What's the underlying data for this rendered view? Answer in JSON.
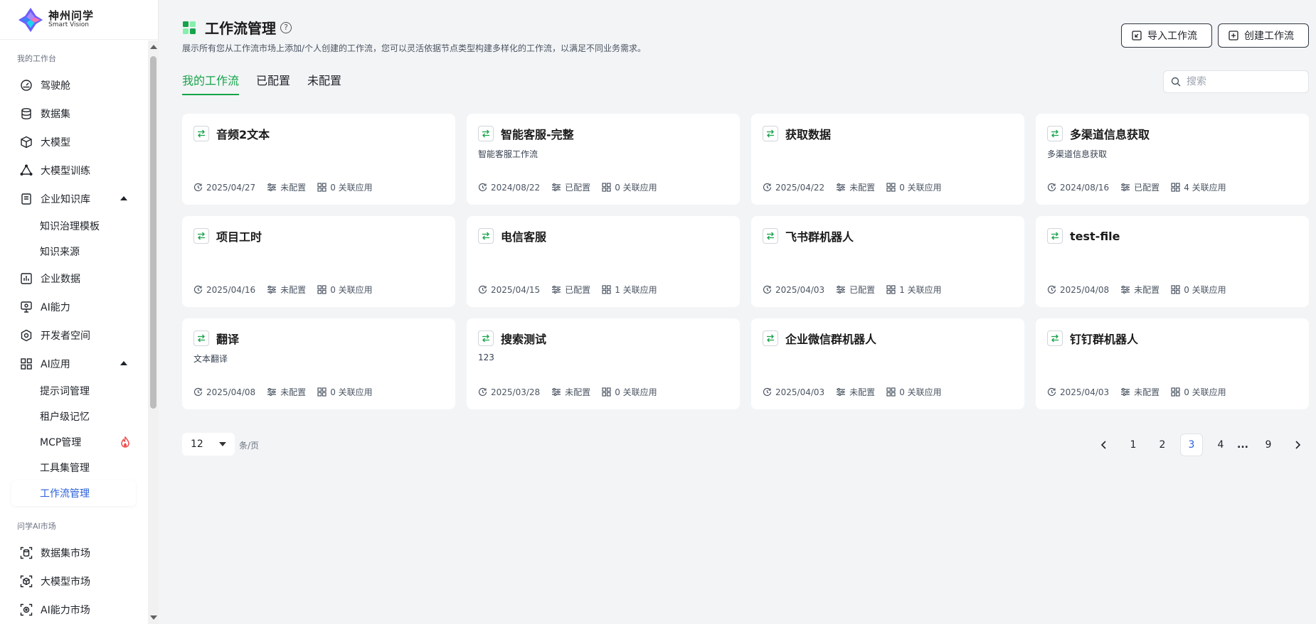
{
  "brand": {
    "name_cn": "神州问学",
    "name_en": "Smart Vision"
  },
  "sidebar": {
    "section1_title": "我的工作台",
    "items": [
      {
        "label": "驾驶舱",
        "icon": "dashboard-icon"
      },
      {
        "label": "数据集",
        "icon": "database-icon"
      },
      {
        "label": "大模型",
        "icon": "cube-icon"
      },
      {
        "label": "大模型训练",
        "icon": "training-icon"
      },
      {
        "label": "企业知识库",
        "icon": "knowledge-icon",
        "expanded": true
      },
      {
        "label": "知识治理模板",
        "sub": true
      },
      {
        "label": "知识来源",
        "sub": true
      },
      {
        "label": "企业数据",
        "icon": "chart-icon"
      },
      {
        "label": "AI能力",
        "icon": "monitor-icon"
      },
      {
        "label": "开发者空间",
        "icon": "developer-icon"
      },
      {
        "label": "AI应用",
        "icon": "apps-icon",
        "expanded": true
      },
      {
        "label": "提示词管理",
        "sub": true
      },
      {
        "label": "租户级记忆",
        "sub": true
      },
      {
        "label": "MCP管理",
        "sub": true,
        "hot": true
      },
      {
        "label": "工具集管理",
        "sub": true
      },
      {
        "label": "工作流管理",
        "sub": true,
        "active": true
      }
    ],
    "section2_title": "问学AI市场",
    "market_items": [
      {
        "label": "数据集市场",
        "icon": "dataset-market-icon"
      },
      {
        "label": "大模型市场",
        "icon": "model-market-icon"
      },
      {
        "label": "AI能力市场",
        "icon": "ai-market-icon"
      }
    ]
  },
  "header": {
    "title": "工作流管理",
    "help": "?",
    "description": "展示所有您从工作流市场上添加/个人创建的工作流，您可以灵活依据节点类型构建多样化的工作流，以满足不同业务需求。",
    "import_label": "导入工作流",
    "create_label": "创建工作流"
  },
  "tabs": [
    {
      "label": "我的工作流",
      "active": true
    },
    {
      "label": "已配置",
      "active": false
    },
    {
      "label": "未配置",
      "active": false
    }
  ],
  "search": {
    "placeholder": "搜索",
    "value": ""
  },
  "cards": [
    {
      "title": "音频2文本",
      "desc": "",
      "date": "2025/04/27",
      "status": "未配置",
      "apps": "0 关联应用"
    },
    {
      "title": "智能客服-完整",
      "desc": "智能客服工作流",
      "date": "2024/08/22",
      "status": "已配置",
      "apps": "0 关联应用"
    },
    {
      "title": "获取数据",
      "desc": "",
      "date": "2025/04/22",
      "status": "未配置",
      "apps": "0 关联应用"
    },
    {
      "title": "多渠道信息获取",
      "desc": "多渠道信息获取",
      "date": "2024/08/16",
      "status": "已配置",
      "apps": "4 关联应用"
    },
    {
      "title": "项目工时",
      "desc": "",
      "date": "2025/04/16",
      "status": "未配置",
      "apps": "0 关联应用"
    },
    {
      "title": "电信客服",
      "desc": "",
      "date": "2025/04/15",
      "status": "已配置",
      "apps": "1 关联应用"
    },
    {
      "title": "飞书群机器人",
      "desc": "",
      "date": "2025/04/03",
      "status": "已配置",
      "apps": "1 关联应用"
    },
    {
      "title": "test-file",
      "desc": "",
      "date": "2025/04/08",
      "status": "未配置",
      "apps": "0 关联应用"
    },
    {
      "title": "翻译",
      "desc": "文本翻译",
      "date": "2025/04/08",
      "status": "未配置",
      "apps": "0 关联应用"
    },
    {
      "title": "搜索测试",
      "desc": "123",
      "date": "2025/03/28",
      "status": "未配置",
      "apps": "0 关联应用"
    },
    {
      "title": "企业微信群机器人",
      "desc": "",
      "date": "2025/04/03",
      "status": "未配置",
      "apps": "0 关联应用"
    },
    {
      "title": "钉钉群机器人",
      "desc": "",
      "date": "2025/04/03",
      "status": "未配置",
      "apps": "0 关联应用"
    }
  ],
  "pagination": {
    "page_size": "12",
    "unit": "条/页",
    "pages": [
      "1",
      "2",
      "3",
      "4",
      "...",
      "9"
    ],
    "current": "3"
  },
  "colors": {
    "accent_green": "#16a34a",
    "active_blue": "#2a5fd8",
    "flame": "#ef4444"
  }
}
